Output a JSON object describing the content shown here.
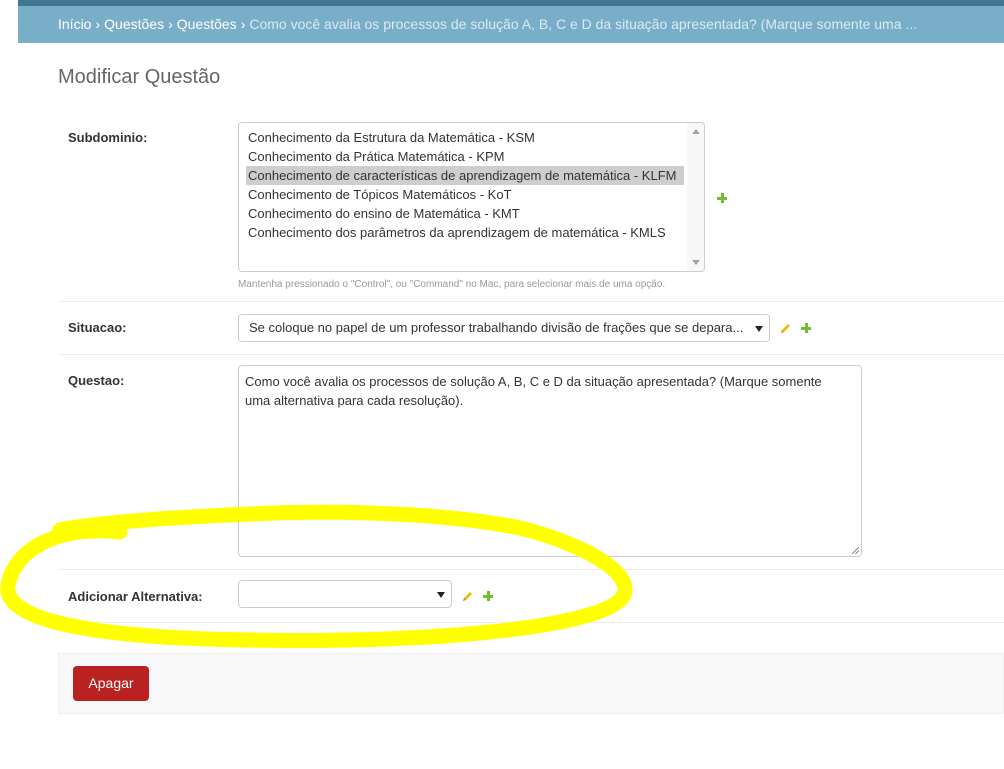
{
  "breadcrumb": {
    "items": [
      "Início",
      "Questões",
      "Questões"
    ],
    "separator": "›",
    "current": "Como você avalia os processos de solução A, B, C e D da situação apresentada? (Marque somente uma ..."
  },
  "page_title": "Modificar Questão",
  "subdominio": {
    "label": "Subdominio:",
    "options": [
      "Conhecimento da Estrutura da Matemática - KSM",
      "Conhecimento da Prática Matemática - KPM",
      "Conhecimento de características de aprendizagem de matemática - KLFM",
      "Conhecimento de Tópicos Matemáticos - KoT",
      "Conhecimento do ensino de Matemática - KMT",
      "Conhecimento dos parâmetros da aprendizagem de matemática - KMLS"
    ],
    "selected_index": 2,
    "help_text": "Mantenha pressionado o \"Control\", ou \"Command\" no Mac, para selecionar mais de uma opção."
  },
  "situacao": {
    "label": "Situacao:",
    "value": "Se coloque no papel de um professor trabalhando divisão de frações que se depara..."
  },
  "questao": {
    "label": "Questao:",
    "value": "Como você avalia os processos de solução A, B, C e D da situação apresentada? (Marque somente uma alternativa para cada resolução)."
  },
  "adicionar_alternativa": {
    "label": "Adicionar Alternativa:",
    "value": ""
  },
  "actions": {
    "delete_label": "Apagar"
  },
  "colors": {
    "header": "#79aec8",
    "header_border": "#417690",
    "delete_button": "#ba2121",
    "add_icon": "#70bf2b",
    "edit_icon": "#efb80b",
    "highlight": "#ffff00"
  }
}
